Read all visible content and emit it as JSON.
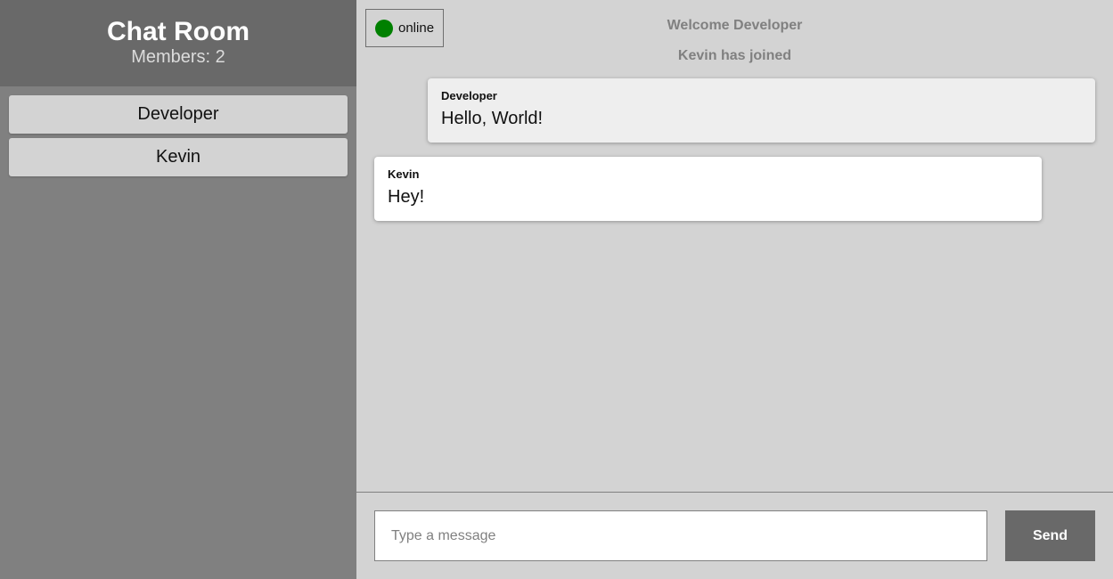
{
  "sidebar": {
    "title": "Chat Room",
    "member_count": "Members: 2",
    "members": [
      {
        "name": "Developer"
      },
      {
        "name": "Kevin"
      }
    ]
  },
  "status": {
    "label": "online",
    "color": "#008000"
  },
  "system_messages": [
    "Welcome Developer",
    "Kevin has joined"
  ],
  "messages": [
    {
      "sender": "Developer",
      "text": "Hello, World!",
      "own": true
    },
    {
      "sender": "Kevin",
      "text": "Hey!",
      "own": false
    }
  ],
  "composer": {
    "placeholder": "Type a message",
    "value": "",
    "send_label": "Send"
  },
  "colors": {
    "sidebar_bg": "#808080",
    "sidebar_header_bg": "#696969",
    "main_bg": "#d3d3d3",
    "send_button_bg": "#696969"
  }
}
